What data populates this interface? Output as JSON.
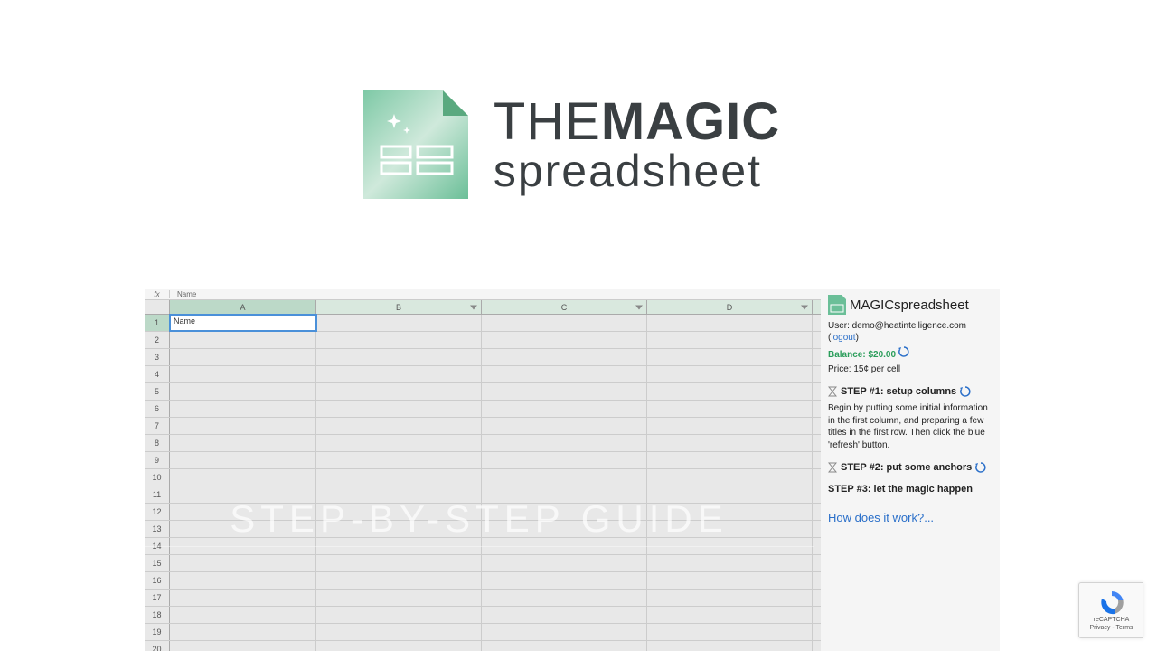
{
  "logo": {
    "top_thin": "THE",
    "top_bold": "MAGIC",
    "bottom": "spreadsheet"
  },
  "sheet": {
    "fx_label": "fx",
    "fx_value": "Name",
    "columns": [
      "A",
      "B",
      "C",
      "D"
    ],
    "rows": [
      "1",
      "2",
      "3",
      "4",
      "5",
      "6",
      "7",
      "8",
      "9",
      "10",
      "11",
      "12",
      "13",
      "14",
      "15",
      "16",
      "17",
      "18",
      "19",
      "20"
    ],
    "cell_A1": "Name"
  },
  "overlay": "STEP-BY-STEP GUIDE",
  "sidebar": {
    "brand_bold": "MAGIC",
    "brand_thin": "spreadsheet",
    "user_label": "User: ",
    "user_email": "demo@heatintelligence.com",
    "logout": "logout",
    "balance_label": "Balance: ",
    "balance_value": "$20.00",
    "price": "Price: 15¢ per cell",
    "step1": "STEP #1: setup columns",
    "step1_body": "Begin by putting some initial information in the first column, and preparing a few titles in the first row. Then click the blue 'refresh' button.",
    "step2": "STEP #2: put some anchors",
    "step3": "STEP #3: let the magic happen",
    "how": "How does it work?..."
  },
  "recaptcha": {
    "label": "reCAPTCHA",
    "links": "Privacy - Terms"
  }
}
